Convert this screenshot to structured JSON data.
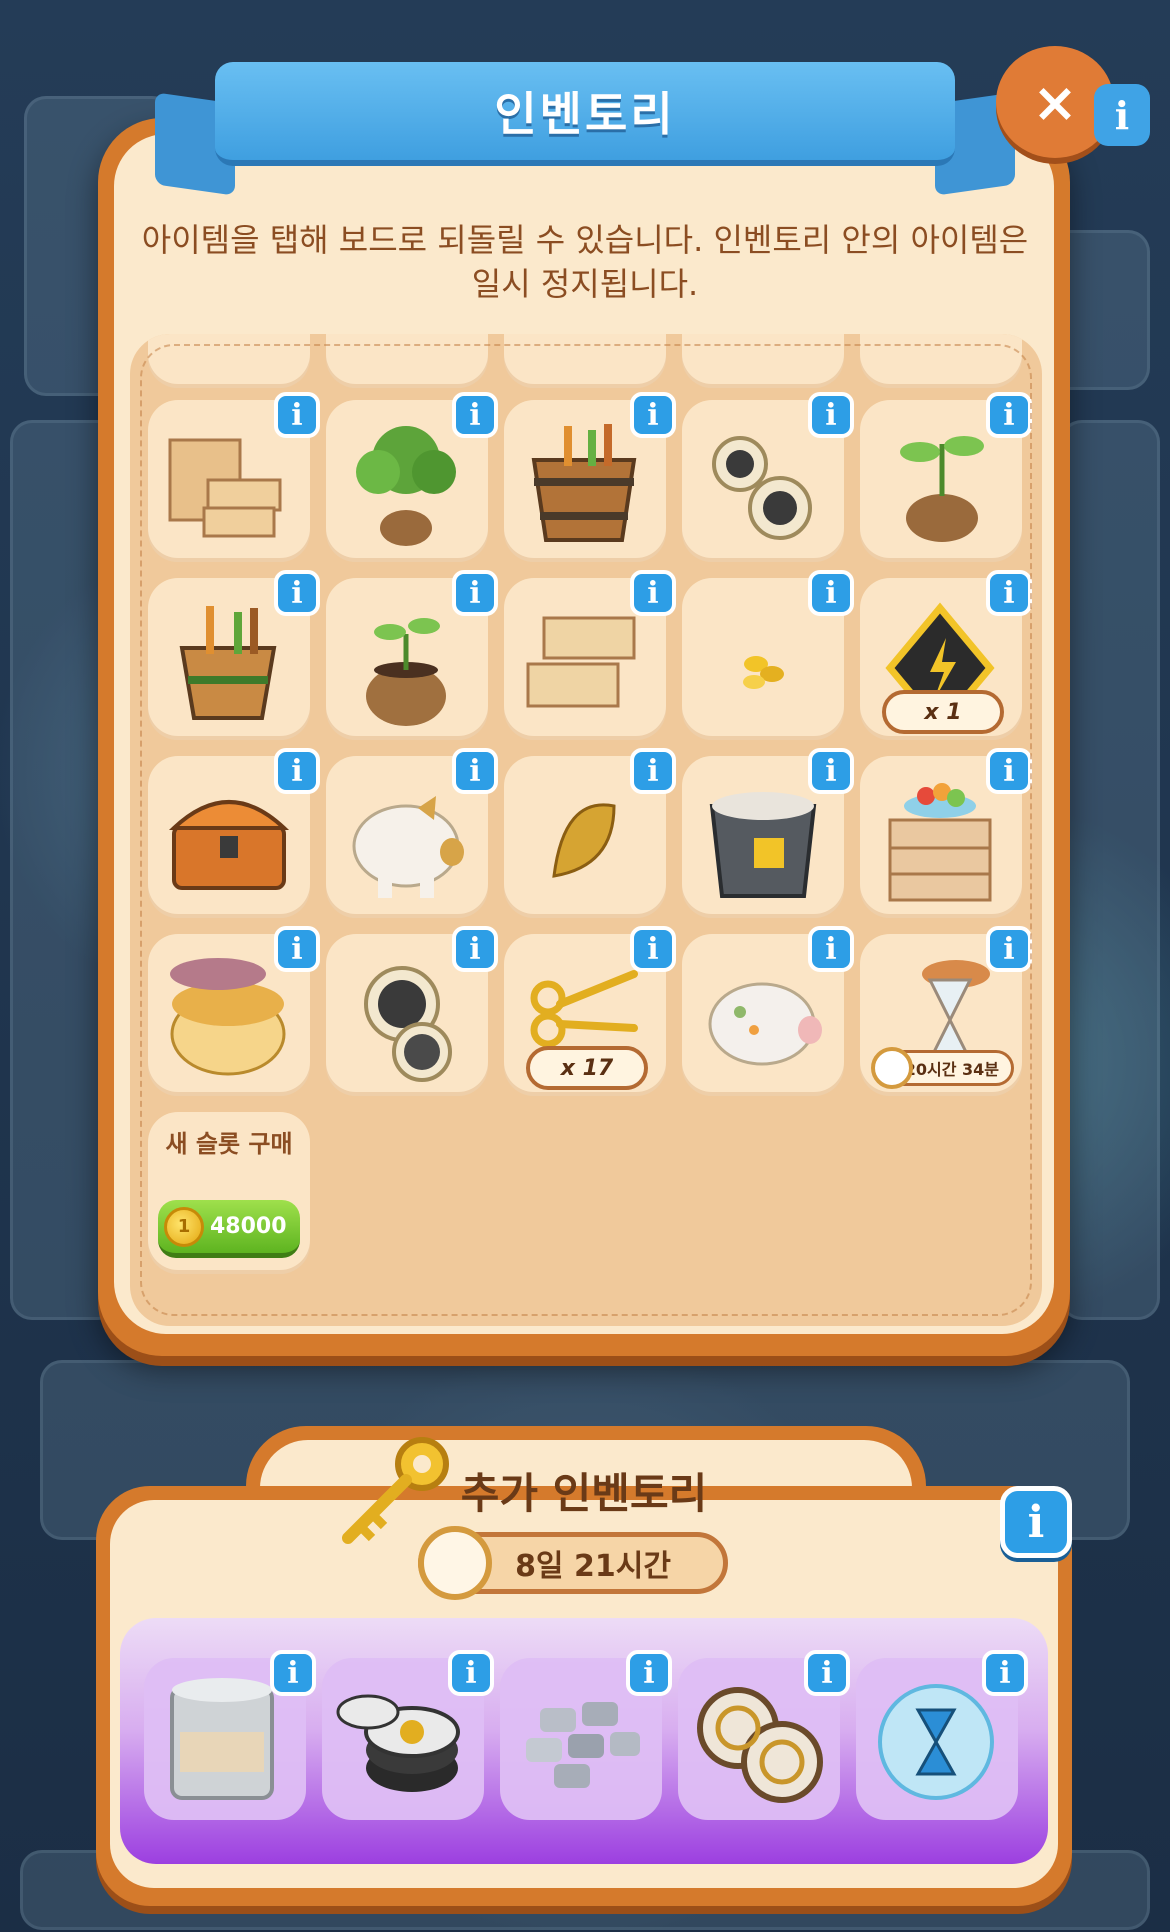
{
  "inventory": {
    "title": "인벤토리",
    "close_label": "×",
    "top_info_label": "i",
    "description": "아이템을 탭해 보드로 되돌릴 수 있습니다. 인벤토리 안의 아이템은 일시 정지됩니다.",
    "info_label": "i",
    "rows": [
      [
        {
          "icon": "wooden-shelf-boxes-icon"
        },
        {
          "icon": "potted-tree-icon"
        },
        {
          "icon": "tool-barrel-icon"
        },
        {
          "icon": "photo-lockets-icon"
        },
        {
          "icon": "sprout-pot-icon"
        }
      ],
      [
        {
          "icon": "tool-bucket-icon"
        },
        {
          "icon": "seedling-pot-icon"
        },
        {
          "icon": "stacked-crates-icon"
        },
        {
          "icon": "gold-nuggets-icon"
        },
        {
          "icon": "energy-warning-sign-icon",
          "count": "x 1"
        }
      ],
      [
        {
          "icon": "treasure-chest-icon"
        },
        {
          "icon": "gold-piggy-bank-icon"
        },
        {
          "icon": "gold-leaf-icon"
        },
        {
          "icon": "energy-paint-bucket-icon"
        },
        {
          "icon": "dresser-fruit-bowl-icon"
        }
      ],
      [
        {
          "icon": "golden-cream-jar-icon"
        },
        {
          "icon": "portrait-locket-icon"
        },
        {
          "icon": "golden-scissors-icon",
          "count": "x 17"
        },
        {
          "icon": "floral-piggy-bank-icon"
        },
        {
          "icon": "hourglass-icon",
          "timer": "20시간 34분"
        }
      ]
    ],
    "buy_slot": {
      "label": "새 슬롯 구매",
      "coin_symbol": "1",
      "price": "48000"
    }
  },
  "extra_inventory": {
    "title": "추가 인벤토리",
    "timer": "8일 21시간",
    "info_label": "i",
    "items": [
      {
        "icon": "paint-can-icon"
      },
      {
        "icon": "tire-stack-icon"
      },
      {
        "icon": "stone-tiles-icon"
      },
      {
        "icon": "wagon-wheels-icon"
      },
      {
        "icon": "hourglass-bubble-icon"
      }
    ]
  },
  "colors": {
    "panel_orange": "#d57a2c",
    "panel_cream": "#fbe9cc",
    "ribbon_blue": "#3f9fe0",
    "info_blue": "#2d9ee6",
    "buy_green": "#5eb420",
    "tray_purple": "#9c3fe0"
  }
}
